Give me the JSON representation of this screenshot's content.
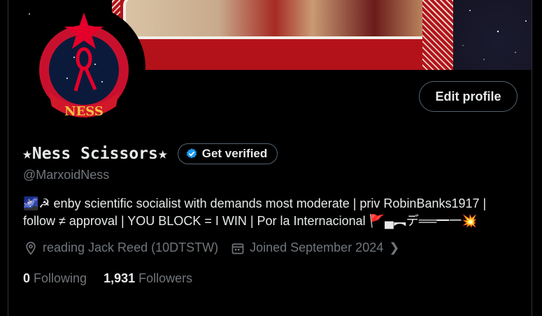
{
  "profile": {
    "display_name": "★Ness Scissors★",
    "handle": "@MarxoidNess",
    "bio_line1": "🌌☭ enby scientific socialist with demands most moderate | priv RobinBanks1917 |",
    "bio_line2": "follow ≠ approval | YOU BLOCK = I WIN |  Por la Internacional  🚩▄︻デ══━一💥",
    "location": "reading Jack Reed (10DTSTW)",
    "joined": "Joined September 2024",
    "following_count": "0",
    "following_label": "Following",
    "followers_count": "1,931",
    "followers_label": "Followers",
    "avatar_text": "NESS"
  },
  "buttons": {
    "edit_profile": "Edit profile",
    "get_verified": "Get verified"
  },
  "icons": {
    "location": "location-pin-icon",
    "calendar": "calendar-icon",
    "verified": "verified-badge-icon",
    "chevron": "chevron-right-icon"
  },
  "colors": {
    "background": "#000000",
    "text": "#e7e9ea",
    "muted": "#71767b",
    "verified_blue": "#1d9bf0",
    "banner_red": "#b3121a"
  }
}
